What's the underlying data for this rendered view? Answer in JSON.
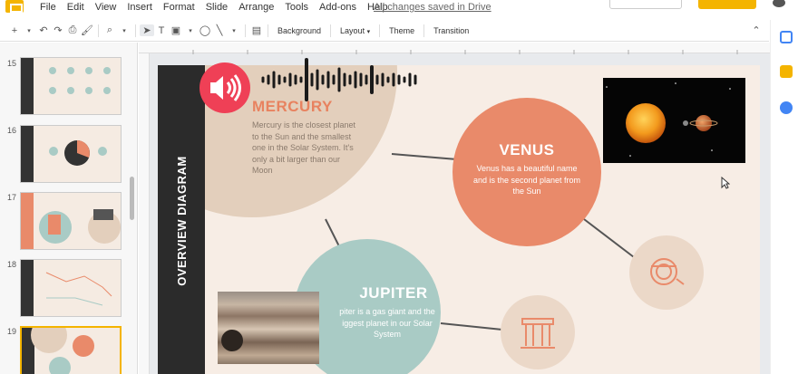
{
  "menu": {
    "items": [
      "File",
      "Edit",
      "View",
      "Insert",
      "Format",
      "Slide",
      "Arrange",
      "Tools",
      "Add-ons",
      "Help"
    ],
    "status": "All changes saved in Drive"
  },
  "toolbar": {
    "background": "Background",
    "layout": "Layout",
    "theme": "Theme",
    "transition": "Transition"
  },
  "filmstrip": {
    "slide_numbers": [
      "15",
      "16",
      "17",
      "18",
      "19"
    ],
    "selected": "19"
  },
  "slide": {
    "strip_title": "OVERVIEW DIAGRAM",
    "mercury": {
      "title": "MERCURY",
      "lines": [
        "Mercury is the closest planet",
        "to the Sun and the smallest",
        "one in the Solar System. It's",
        "only a bit larger than our",
        "Moon"
      ]
    },
    "venus": {
      "title": "VENUS",
      "lines": [
        "Venus has a beautiful name",
        "and is the second planet from",
        "the Sun"
      ]
    },
    "jupiter": {
      "title": "JUPITER",
      "lines": [
        "piter is a gas giant and the",
        "iggest planet in our Solar",
        "System"
      ]
    }
  },
  "colors": {
    "accent_yellow": "#f4b400",
    "slide_bg": "#f7ede5",
    "mercury_circle": "#e3cfbc",
    "venus_circle": "#e98a6a",
    "jupiter_circle": "#a9cbc5",
    "title_orange": "#e8825f",
    "dark_strip": "#2b2b2b",
    "sound_button": "#ef4056"
  }
}
